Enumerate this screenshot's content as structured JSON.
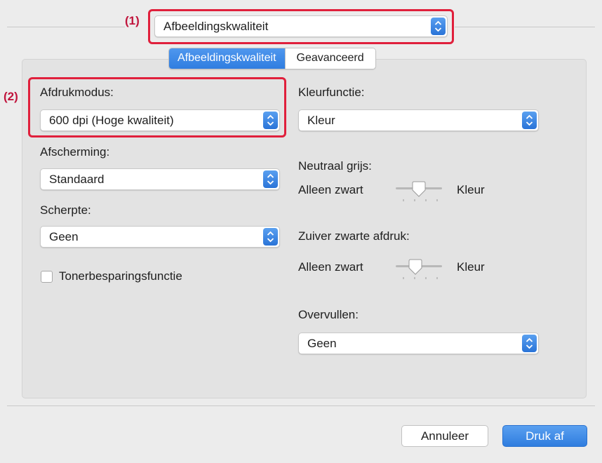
{
  "annotations": {
    "callout_1": "(1)",
    "callout_2": "(2)"
  },
  "preset_menu": {
    "value": "Afbeeldingskwaliteit"
  },
  "tabs": [
    {
      "label": "Afbeeldingskwaliteit",
      "active": true
    },
    {
      "label": "Geavanceerd",
      "active": false
    }
  ],
  "left": {
    "print_mode": {
      "label": "Afdrukmodus:",
      "value": "600 dpi (Hoge kwaliteit)"
    },
    "screening": {
      "label": "Afscherming:",
      "value": "Standaard"
    },
    "sharpness": {
      "label": "Scherpte:",
      "value": "Geen"
    },
    "toner_saving": {
      "label": "Tonerbesparingsfunctie",
      "checked": false
    }
  },
  "right": {
    "color_mode": {
      "label": "Kleurfunctie:",
      "value": "Kleur"
    },
    "neutral_gray": {
      "label": "Neutraal grijs:",
      "min_label": "Alleen zwart",
      "max_label": "Kleur",
      "level": 0.5
    },
    "pure_black": {
      "label": "Zuiver zwarte afdruk:",
      "min_label": "Alleen zwart",
      "max_label": "Kleur",
      "level": 0.33
    },
    "trapping": {
      "label": "Overvullen:",
      "value": "Geen"
    }
  },
  "buttons": {
    "cancel": "Annuleer",
    "print": "Druk af"
  },
  "colors": {
    "accent": "#2f7de0",
    "callout": "#e0203c",
    "panel": "#e3e3e3"
  }
}
